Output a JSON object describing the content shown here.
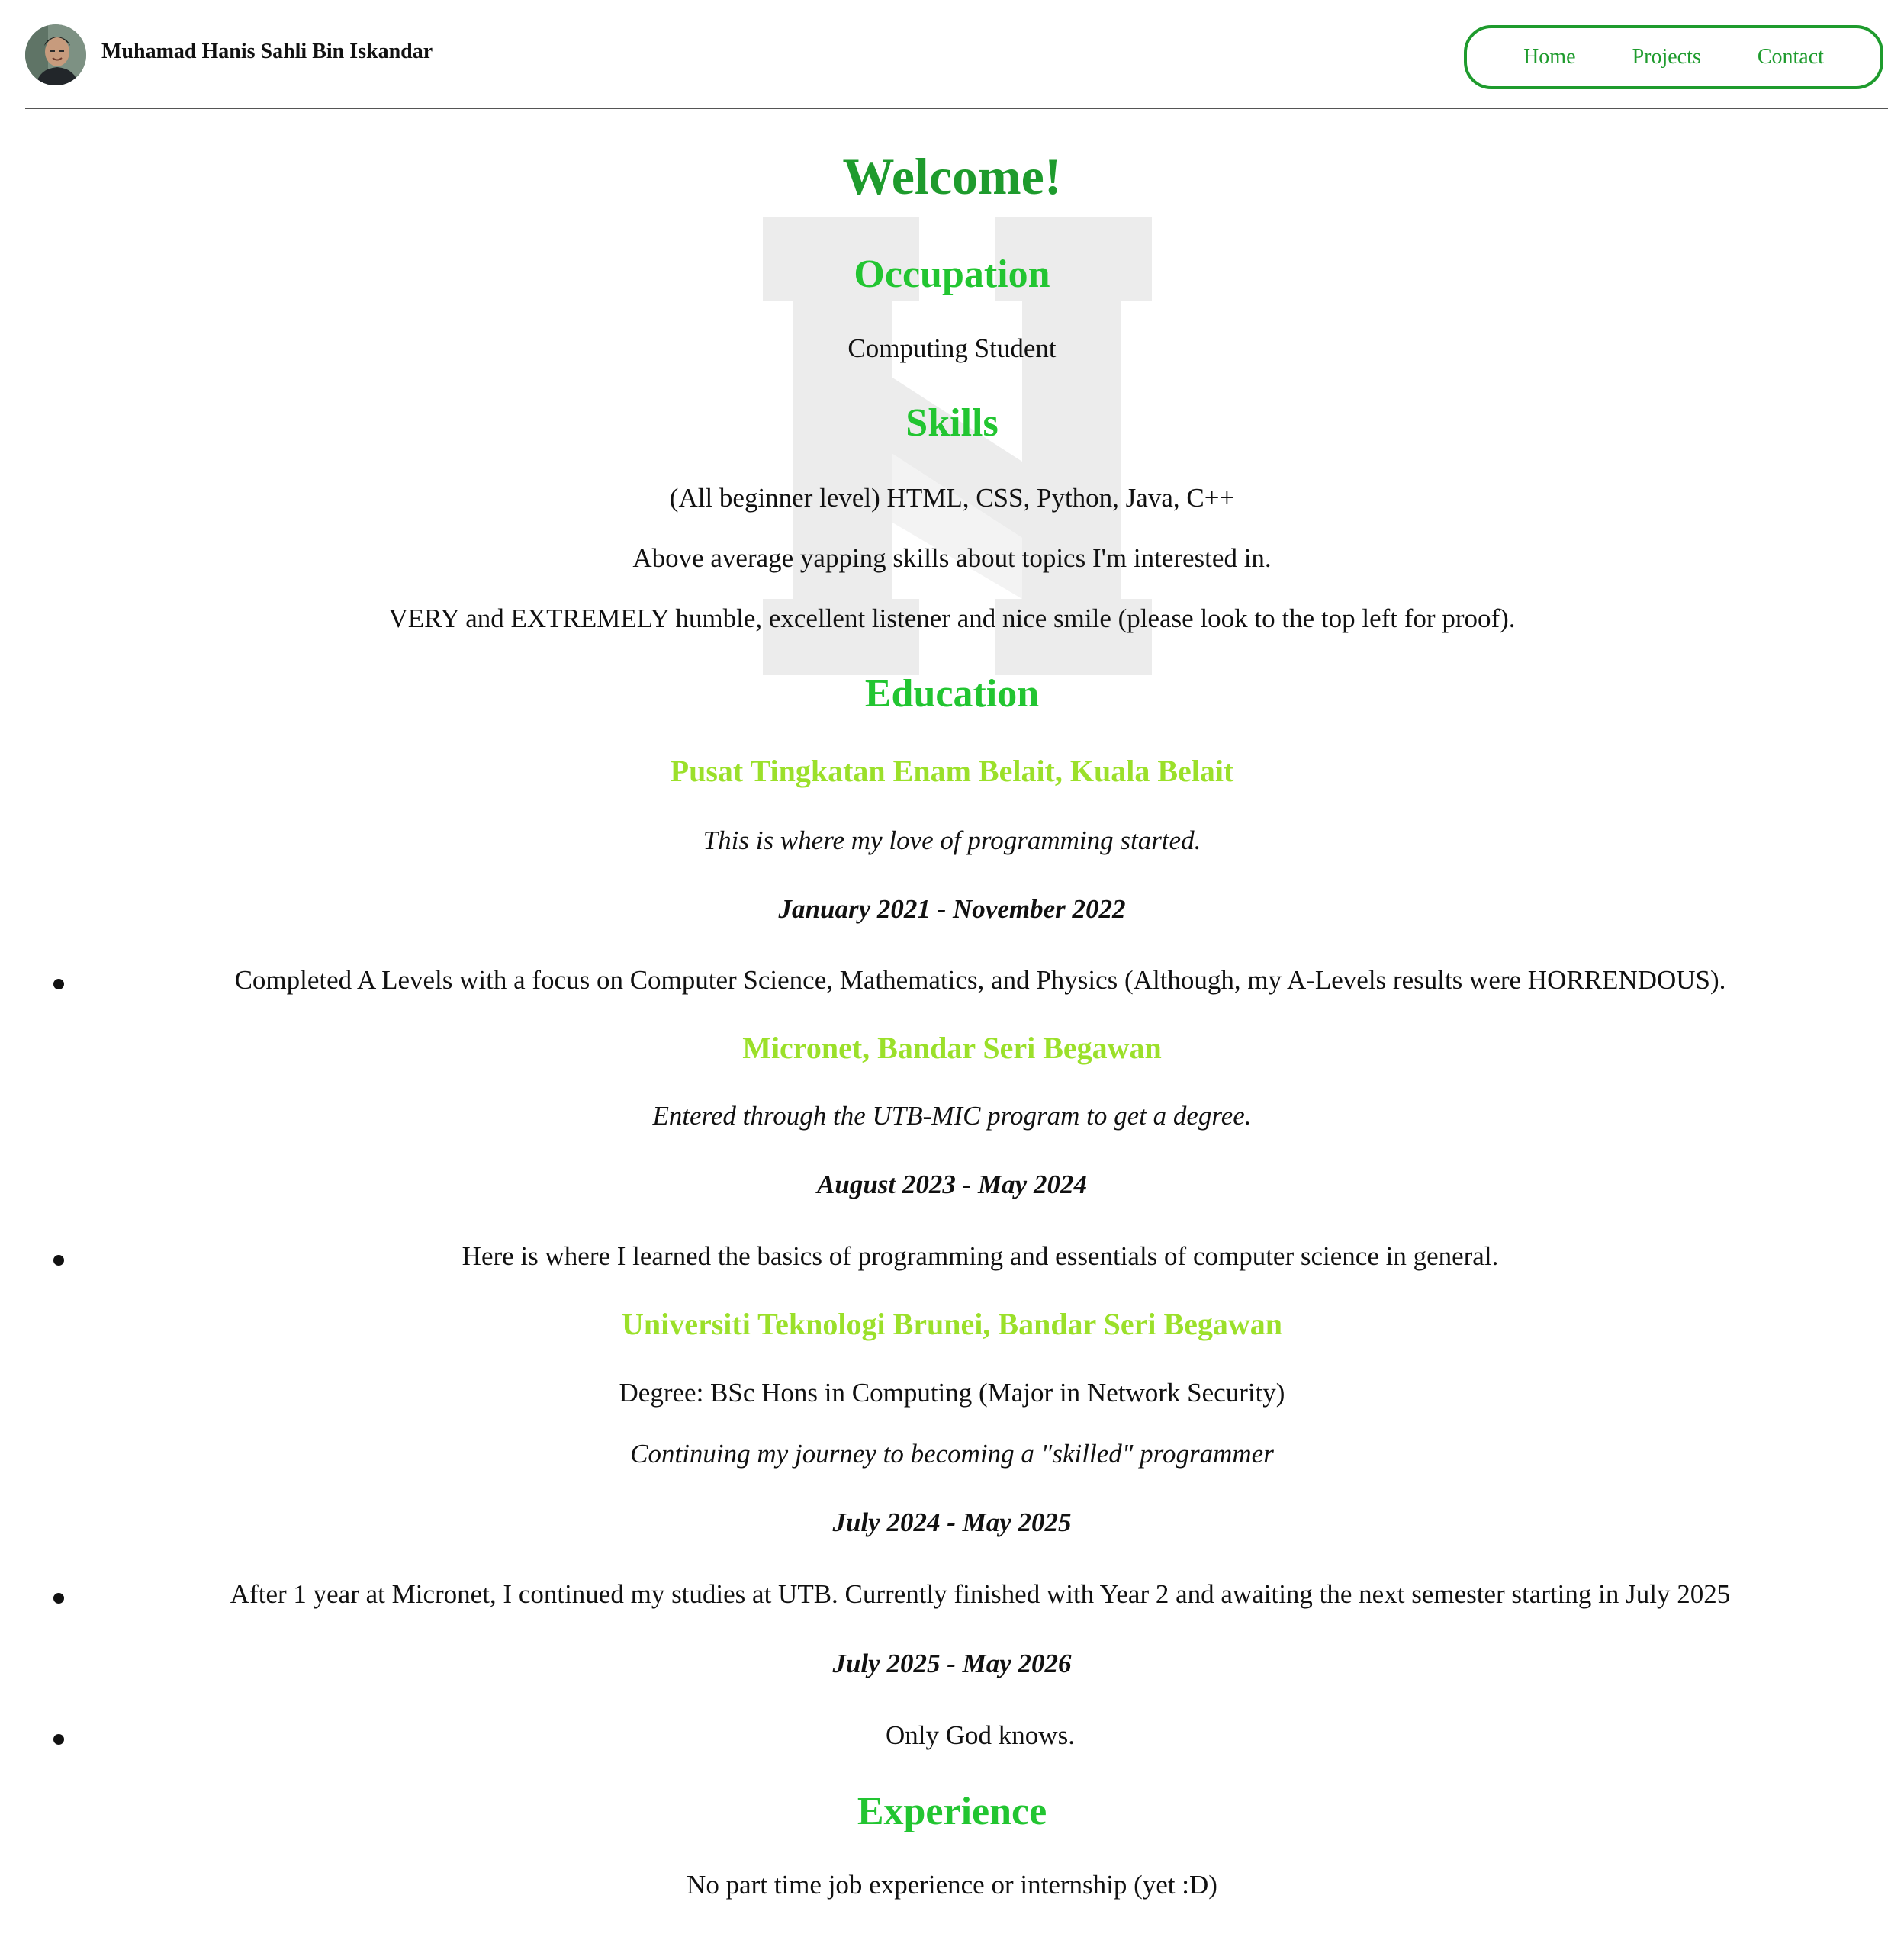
{
  "header": {
    "name": "Muhamad Hanis Sahli Bin Iskandar",
    "nav": [
      "Home",
      "Projects",
      "Contact"
    ]
  },
  "colors": {
    "primary_green": "#1e9b2d",
    "section_green": "#22c531",
    "subheading_lime": "#9be02a"
  },
  "main": {
    "welcome": "Welcome!",
    "occupation_heading": "Occupation",
    "occupation": "Computing Student",
    "skills_heading": "Skills",
    "skills": [
      "(All beginner level) HTML, CSS, Python, Java, C++",
      "Above average yapping skills about topics I'm interested in.",
      "VERY and EXTREMELY humble, excellent listener and nice smile (please look to the top left for proof)."
    ],
    "education_heading": "Education",
    "education": [
      {
        "school": "Pusat Tingkatan Enam Belait, Kuala Belait",
        "note": "This is where my love of programming started.",
        "period": "January 2021 - November 2022",
        "bullet": "Completed A Levels with a focus on Computer Science, Mathematics, and Physics (Although, my A-Levels results were HORRENDOUS)."
      },
      {
        "school": "Micronet, Bandar Seri Begawan",
        "note": "Entered through the UTB-MIC program to get a degree.",
        "period": "August 2023 - May 2024",
        "bullet": "Here is where I learned the basics of programming and essentials of computer science in general."
      },
      {
        "school": "Universiti Teknologi Brunei, Bandar Seri Begawan",
        "degree": "Degree: BSc Hons in Computing (Major in Network Security)",
        "note": "Continuing my journey to becoming a \"skilled\" programmer",
        "periods": [
          {
            "period": "July 2024 - May 2025",
            "bullet": "After 1 year at Micronet, I continued my studies at UTB. Currently finished with Year 2 and awaiting the next semester starting in July 2025"
          },
          {
            "period": "July 2025 - May 2026",
            "bullet": "Only God knows."
          }
        ]
      }
    ],
    "experience_heading": "Experience",
    "experience": "No part time job experience or internship (yet :D)"
  }
}
